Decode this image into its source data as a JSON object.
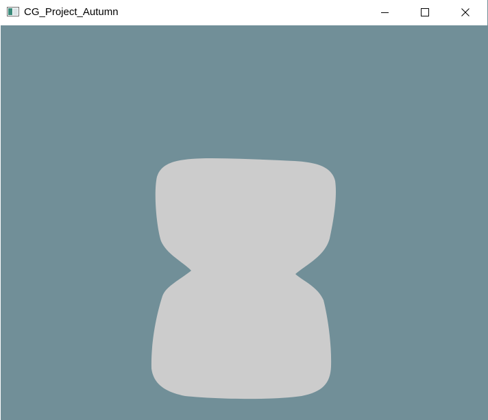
{
  "window": {
    "title": "CG_Project_Autumn",
    "icon": "app-window-icon",
    "caption_buttons": [
      {
        "name": "minimize",
        "icon": "minimize-icon"
      },
      {
        "name": "maximize",
        "icon": "maximize-icon"
      },
      {
        "name": "close",
        "icon": "close-icon"
      }
    ]
  },
  "viewport": {
    "clear_color": "#718f98",
    "shape_color": "#cccccc"
  }
}
